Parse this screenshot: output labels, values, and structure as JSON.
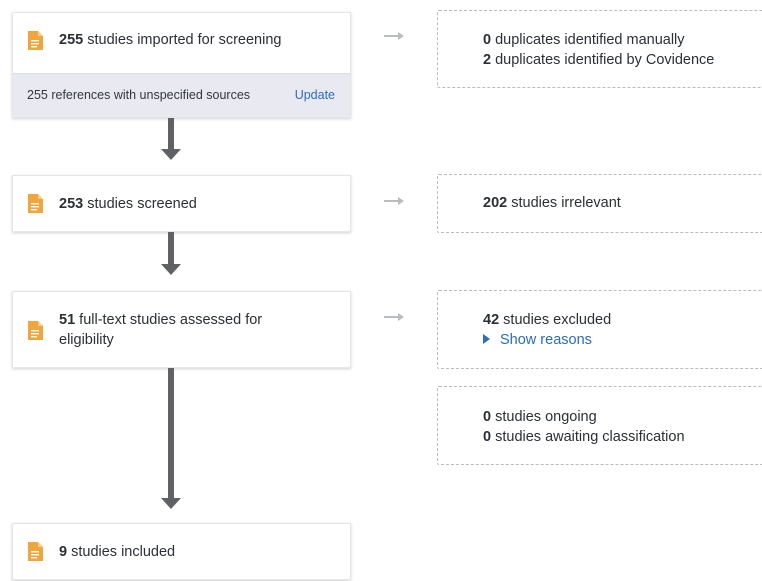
{
  "colors": {
    "doc_icon": "#f0a63c",
    "link": "#2b6cc4",
    "arrow": "#5f6166",
    "footer_bg": "#e9eaf1"
  },
  "icons": {
    "document": "document-icon",
    "arrow_down": "arrow-down-icon",
    "arrow_right": "arrow-right-icon",
    "disclosure": "caret-right-icon"
  },
  "stages": {
    "imported": {
      "count": "255",
      "text": " studies imported for screening",
      "footer_text": "255 references with unspecified sources",
      "footer_link": "Update"
    },
    "screened": {
      "count": "253",
      "text": " studies screened"
    },
    "fulltext": {
      "count": "51",
      "text": " full-text studies assessed for eligibility"
    },
    "included": {
      "count": "9",
      "text": " studies included"
    }
  },
  "side": {
    "duplicates": {
      "manual_count": "0",
      "manual_text": " duplicates identified manually",
      "auto_count": "2",
      "auto_text": " duplicates identified by Covidence"
    },
    "irrelevant": {
      "count": "202",
      "text": " studies irrelevant"
    },
    "excluded": {
      "count": "42",
      "text": " studies excluded",
      "reasons_link": "Show reasons"
    },
    "other": {
      "ongoing_count": "0",
      "ongoing_text": " studies ongoing",
      "awaiting_count": "0",
      "awaiting_text": " studies awaiting classification"
    }
  }
}
